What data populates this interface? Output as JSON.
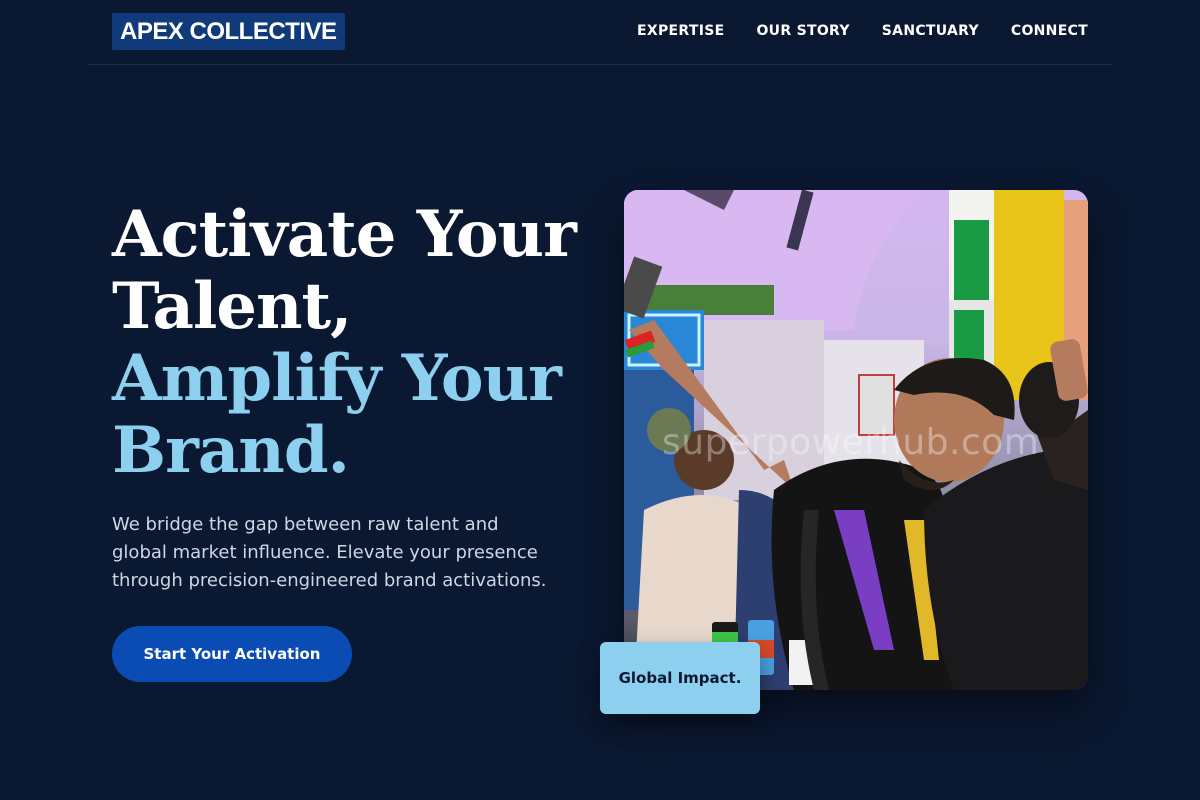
{
  "header": {
    "logo": "APEX COLLECTIVE",
    "nav": [
      {
        "label": "EXPERTISE"
      },
      {
        "label": "OUR STORY"
      },
      {
        "label": "SANCTUARY"
      },
      {
        "label": "CONNECT"
      }
    ]
  },
  "hero": {
    "headline_lines": [
      "Activate Your",
      "Talent,"
    ],
    "highlight_lines": [
      "Amplify Your",
      "Brand."
    ],
    "lead_lines": [
      "We bridge the gap between raw talent and",
      "global market influence. Elevate your presence",
      "through precision-engineered brand activations."
    ],
    "cta_label": "Start Your Activation"
  },
  "media": {
    "watermark": "superpowerhub.com",
    "badge_label": "Global Impact."
  },
  "colors": {
    "background": "#0b1831",
    "accent": "#8dcfee",
    "button": "#0a4cb4",
    "logo_bg": "#103a7a"
  }
}
